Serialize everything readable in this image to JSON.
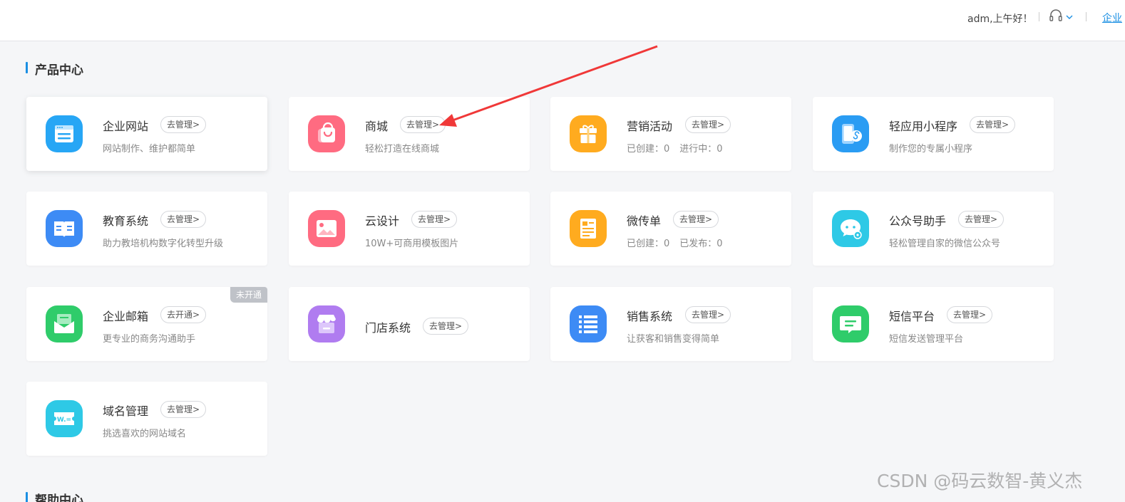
{
  "header": {
    "greeting": "adm,上午好！",
    "link": "企业"
  },
  "sections": {
    "product_center": "产品中心",
    "help_center": "帮助中心"
  },
  "products": [
    {
      "name": "企业网站",
      "action": "去管理>",
      "desc": "网站制作、维护都简单",
      "icon": "website-icon",
      "color": "#27a6f5"
    },
    {
      "name": "商城",
      "action": "去管理>",
      "desc": "轻松打造在线商城",
      "icon": "shopping-bag-icon",
      "color": "#ff6b81"
    },
    {
      "name": "营销活动",
      "action": "去管理>",
      "stats": [
        "已创建：0",
        "进行中：0"
      ],
      "icon": "gift-icon",
      "color": "#ffab1f"
    },
    {
      "name": "轻应用小程序",
      "action": "去管理>",
      "desc": "制作您的专属小程序",
      "icon": "mini-program-icon",
      "color": "#2a9cf3"
    },
    {
      "name": "教育系统",
      "action": "去管理>",
      "desc": "助力教培机构数字化转型升级",
      "icon": "book-icon",
      "color": "#3d8bf5"
    },
    {
      "name": "云设计",
      "action": "去管理>",
      "desc": "10W+可商用模板图片",
      "icon": "image-icon",
      "color": "#ff6b81"
    },
    {
      "name": "微传单",
      "action": "去管理>",
      "stats": [
        "已创建：0",
        "已发布：0"
      ],
      "icon": "flyer-icon",
      "color": "#ffab1f"
    },
    {
      "name": "公众号助手",
      "action": "去管理>",
      "desc": "轻松管理自家的微信公众号",
      "icon": "wechat-settings-icon",
      "color": "#2ec9e6"
    },
    {
      "name": "企业邮箱",
      "action": "去开通>",
      "desc": "更专业的商务沟通助手",
      "icon": "mail-icon",
      "color": "#2fcc6a",
      "badge": "未开通"
    },
    {
      "name": "门店系统",
      "action": "去管理>",
      "icon": "store-icon",
      "color": "#b07cf0"
    },
    {
      "name": "销售系统",
      "action": "去管理>",
      "desc": "让获客和销售变得简单",
      "icon": "list-icon",
      "color": "#3d8bf5"
    },
    {
      "name": "短信平台",
      "action": "去管理>",
      "desc": "短信发送管理平台",
      "icon": "message-icon",
      "color": "#2fcc6a"
    },
    {
      "name": "域名管理",
      "action": "去管理>",
      "desc": "挑选喜欢的网站域名",
      "icon": "domain-icon",
      "color": "#2ec9e6"
    }
  ],
  "watermark": "CSDN @码云数智-黄义杰",
  "annotation_color": "#f03838"
}
